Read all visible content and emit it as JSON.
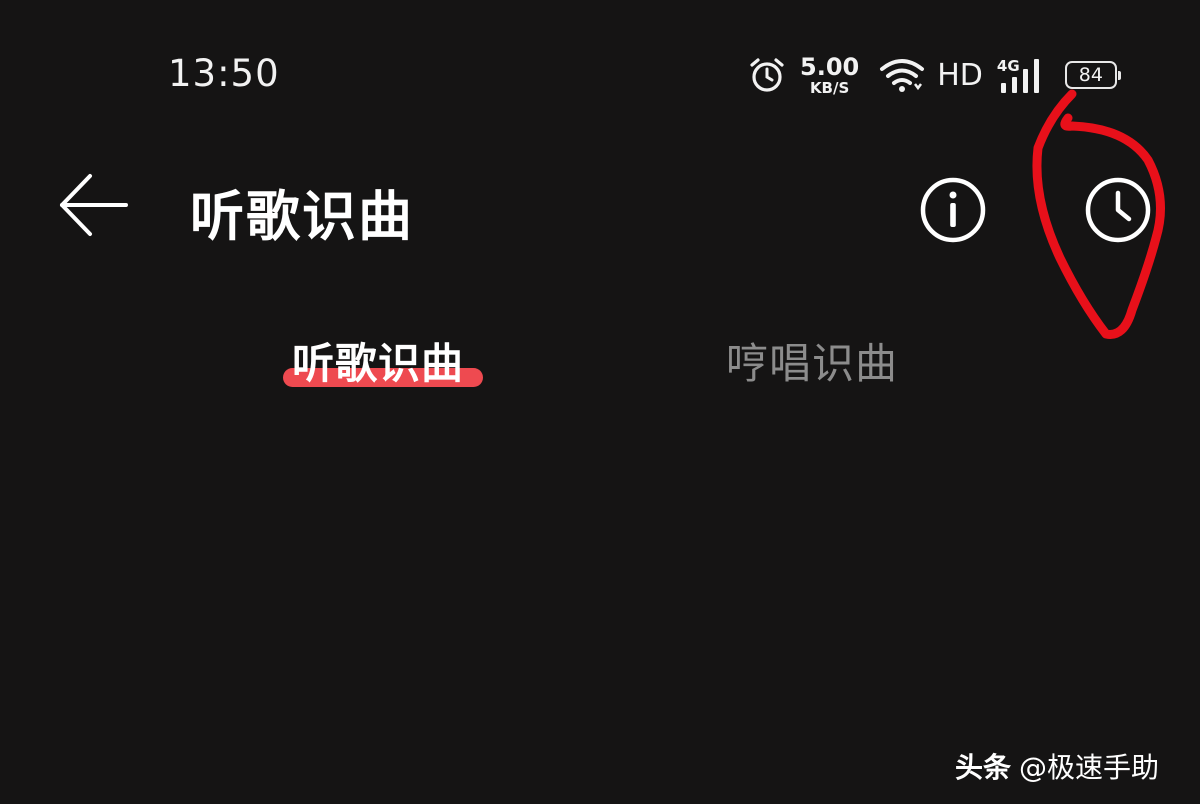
{
  "status_bar": {
    "time": "13:50",
    "net_speed_value": "5.00",
    "net_speed_unit": "KB/S",
    "hd_label": "HD",
    "network_type": "4G",
    "battery_level": "84",
    "icons": [
      "alarm-icon",
      "wifi-icon",
      "signal-icon",
      "battery-icon"
    ]
  },
  "header": {
    "title": "听歌识曲",
    "back_icon": "arrow-left-icon",
    "info_icon": "info-icon",
    "history_icon": "clock-icon"
  },
  "tabs": [
    {
      "label": "听歌识曲",
      "active": true
    },
    {
      "label": "哼唱识曲",
      "active": false
    }
  ],
  "watermark": {
    "brand": "头条",
    "account": "@极速手助"
  },
  "colors": {
    "background": "#151414",
    "accent": "#ee4a50",
    "annotation": "#e8101a",
    "inactive_text": "#8c8c8c"
  }
}
